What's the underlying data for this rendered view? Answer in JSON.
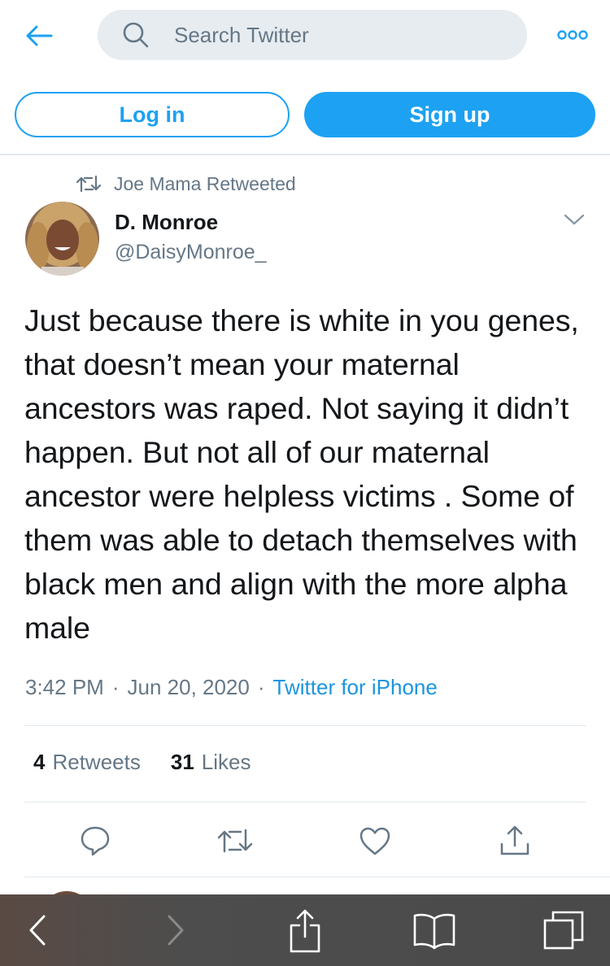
{
  "search": {
    "placeholder": "Search Twitter"
  },
  "auth": {
    "login_label": "Log in",
    "signup_label": "Sign up"
  },
  "tweet": {
    "retweeted_by": "Joe Mama Retweeted",
    "author_name": "D. Monroe",
    "author_handle": "@DaisyMonroe_",
    "text": "Just because there is white in you genes, that doesn’t mean your maternal ancestors was raped. Not saying it didn’t happen. But not all of our maternal ancestor were helpless victims . Some of them was able to detach themselves with black men and align with the more alpha male",
    "time": "3:42 PM",
    "date": "Jun 20, 2020",
    "separator": "·",
    "source": "Twitter for iPhone",
    "retweets_count": "4",
    "retweets_label": "Retweets",
    "likes_count": "31",
    "likes_label": "Likes"
  },
  "colors": {
    "accent": "#1da1f2",
    "link": "#1b95e0",
    "secondary_text": "#657786",
    "primary_text": "#14171a",
    "divider": "#e1e8ed",
    "search_bg": "#e6ecf0",
    "browser_bar": "#4a4a4a"
  },
  "icons": {
    "back": "arrow-left-icon",
    "search": "search-icon",
    "more": "more-icon",
    "retweet_context": "retweet-icon",
    "caret": "chevron-down-icon",
    "reply": "reply-icon",
    "retweet": "retweet-icon",
    "like": "heart-icon",
    "share": "share-icon",
    "browser_back": "chevron-left-icon",
    "browser_forward": "chevron-right-icon",
    "browser_share": "share-icon",
    "bookmarks": "book-icon",
    "tabs": "tabs-icon"
  }
}
